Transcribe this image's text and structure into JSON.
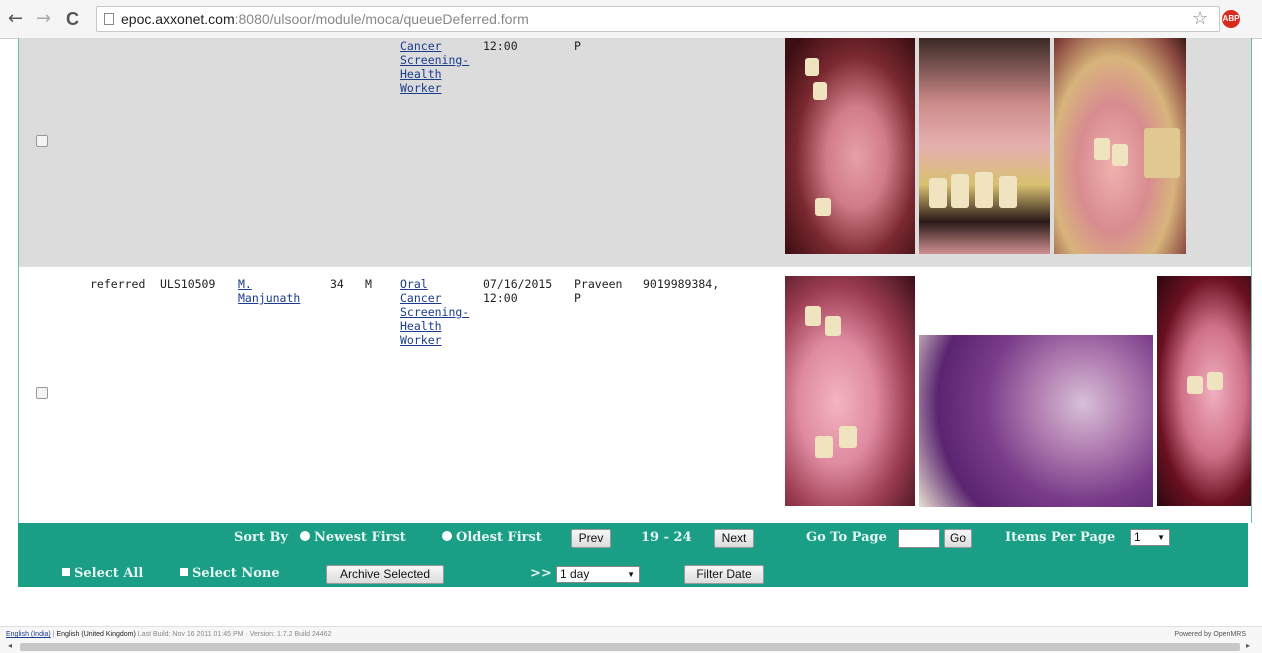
{
  "browser": {
    "back": "←",
    "forward": "→",
    "reload": "C",
    "url_host": "epoc.axxonet.com",
    "url_path": ":8080/ulsoor/module/moca/queueDeferred.form",
    "star": "☆",
    "ext_label": "ABP"
  },
  "rows": [
    {
      "status": "",
      "patient_id": "",
      "patient_name": "",
      "age": "",
      "gender": "",
      "procedure": "Cancer\nScreening-\nHealth\nWorker",
      "date": "12:00",
      "observer": "P",
      "phone": ""
    },
    {
      "status": "referred",
      "patient_id": "ULS10509",
      "patient_name": "M.\nManjunath",
      "age": "34",
      "gender": "M",
      "procedure": "Oral\nCancer\nScreening-\nHealth\nWorker",
      "date": "07/16/2015\n12:00",
      "observer": "Praveen\nP",
      "phone": "9019989384,"
    }
  ],
  "toolbar": {
    "sort_by": "Sort By",
    "newest_first": "Newest First",
    "oldest_first": "Oldest First",
    "prev": "Prev",
    "range": "19 - 24",
    "next": "Next",
    "go_to_page": "Go To Page",
    "go": "Go",
    "items_per_page": "Items Per Page",
    "items_per_page_value": "1",
    "select_all": "Select All",
    "select_none": "Select None",
    "archive_selected": "Archive Selected",
    "date_arrow": ">>",
    "date_range_value": "1 day",
    "filter_date": "Filter Date"
  },
  "footer": {
    "lang_india": "English (India)",
    "lang_sep": " | ",
    "lang_uk": "English (United Kingdom)",
    "build_info": "Last Build: Nov 16 2011 01:45 PM · Version: 1.7.2 Build 24462",
    "powered_by": "Powered by OpenMRS"
  }
}
